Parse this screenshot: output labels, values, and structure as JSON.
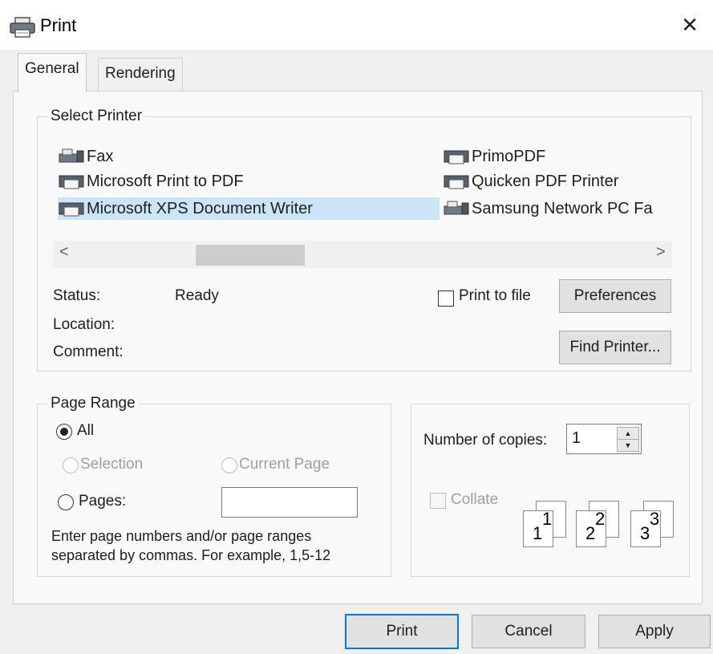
{
  "window": {
    "title": "Print",
    "close_glyph": "✕"
  },
  "tabs": [
    {
      "label": "General"
    },
    {
      "label": "Rendering"
    }
  ],
  "select_printer": {
    "group_label": "Select Printer",
    "printers": [
      {
        "name": "Fax",
        "icon": "fax-printer-icon"
      },
      {
        "name": "Microsoft Print to PDF",
        "icon": "printer-icon"
      },
      {
        "name": "Microsoft XPS Document Writer",
        "icon": "printer-icon",
        "selected": true
      },
      {
        "name": "PrimoPDF",
        "icon": "printer-icon"
      },
      {
        "name": "Quicken PDF Printer",
        "icon": "printer-icon"
      },
      {
        "name": "Samsung Network PC Fa",
        "icon": "fax-printer-icon"
      }
    ],
    "scroll_left_glyph": "<",
    "scroll_right_glyph": ">",
    "status_label": "Status:",
    "status_value": "Ready",
    "location_label": "Location:",
    "comment_label": "Comment:",
    "print_to_file_label": "Print to file",
    "preferences_label": "Preferences",
    "find_printer_label": "Find Printer..."
  },
  "page_range": {
    "group_label": "Page Range",
    "all_label": "All",
    "selection_label": "Selection",
    "current_page_label": "Current Page",
    "pages_label": "Pages:",
    "pages_value": "",
    "help_line1": "Enter page numbers and/or page ranges",
    "help_line2": "separated by commas.  For example, 1,5-12"
  },
  "copies": {
    "number_label": "Number of copies:",
    "number_value": "1",
    "collate_label": "Collate",
    "collate_pages": [
      {
        "front": "1",
        "back": "1"
      },
      {
        "front": "2",
        "back": "2"
      },
      {
        "front": "3",
        "back": "3"
      }
    ]
  },
  "footer": {
    "print_label": "Print",
    "cancel_label": "Cancel",
    "apply_label": "Apply"
  },
  "colors": {
    "accent": "#0078d7",
    "selection": "#cce4f7",
    "disabled_text": "#a0a0a0"
  }
}
